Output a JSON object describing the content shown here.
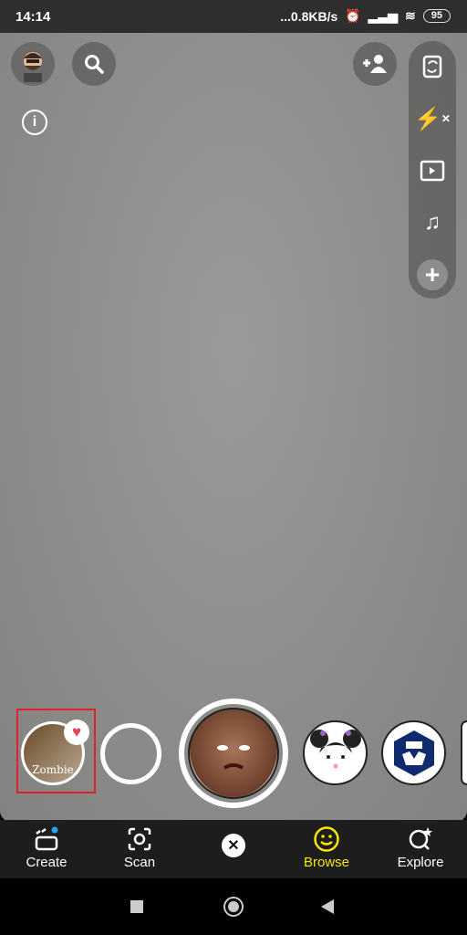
{
  "status": {
    "time": "14:14",
    "network": "...0.8KB/s",
    "battery": "95"
  },
  "top": {
    "icons": [
      "avatar",
      "search-icon",
      "info-icon",
      "add-friend-icon"
    ]
  },
  "toolbar": {
    "icons": [
      "flip-camera-icon",
      "flash-off-icon",
      "video-icon",
      "music-icon",
      "plus-icon"
    ]
  },
  "carousel": {
    "lenses": [
      {
        "name": "Zombie",
        "label": "Zombie",
        "favorited": true,
        "selected_highlight": "#e0222c"
      },
      {
        "name": "empty"
      },
      {
        "name": "old face",
        "active": true
      },
      {
        "name": "girl buns"
      },
      {
        "name": "crypto"
      }
    ]
  },
  "nav": {
    "items": [
      {
        "label": "Create"
      },
      {
        "label": "Scan"
      },
      {
        "label": ""
      },
      {
        "label": "Browse",
        "active": true
      },
      {
        "label": "Explore"
      }
    ],
    "accent": "#f5e500"
  }
}
